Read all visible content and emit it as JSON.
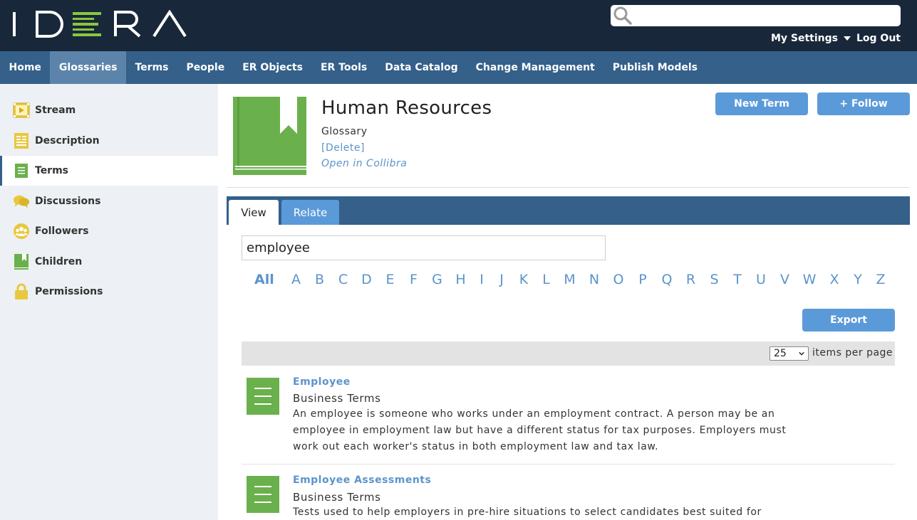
{
  "header": {
    "logo_text": "IDERA",
    "search_placeholder": "",
    "my_settings": "My Settings",
    "log_out": "Log Out"
  },
  "nav": {
    "items": [
      "Home",
      "Glossaries",
      "Terms",
      "People",
      "ER Objects",
      "ER Tools",
      "Data Catalog",
      "Change Management",
      "Publish Models"
    ],
    "active": "Glossaries"
  },
  "sidebar": {
    "items": [
      {
        "label": "Stream",
        "icon": "stream-icon"
      },
      {
        "label": "Description",
        "icon": "description-icon"
      },
      {
        "label": "Terms",
        "icon": "terms-icon"
      },
      {
        "label": "Discussions",
        "icon": "discussions-icon"
      },
      {
        "label": "Followers",
        "icon": "followers-icon"
      },
      {
        "label": "Children",
        "icon": "children-icon"
      },
      {
        "label": "Permissions",
        "icon": "lock-icon"
      }
    ],
    "active": "Terms"
  },
  "glossary": {
    "title": "Human Resources",
    "type": "Glossary",
    "delete_link": "[Delete]",
    "collibra_link": "Open in Collibra",
    "new_term_button": "New Term",
    "follow_button": "+ Follow"
  },
  "tabs": {
    "view": "View",
    "relate": "Relate",
    "active": "View"
  },
  "filter": {
    "value": "employee",
    "letters": [
      "All",
      "A",
      "B",
      "C",
      "D",
      "E",
      "F",
      "G",
      "H",
      "I",
      "J",
      "K",
      "L",
      "M",
      "N",
      "O",
      "P",
      "Q",
      "R",
      "S",
      "T",
      "U",
      "V",
      "W",
      "X",
      "Y",
      "Z"
    ],
    "active_letter": "All",
    "export_button": "Export"
  },
  "pager": {
    "per_page_value": "25",
    "per_page_label": "items per page"
  },
  "terms": [
    {
      "name": "Employee",
      "type": "Business Terms",
      "description": "An employee is someone who works under an employment contract. A person may be an employee in employment law but have a different status for tax purposes. Employers must work out each worker's status in both employment law and tax law."
    },
    {
      "name": "Employee Assessments",
      "type": "Business Terms",
      "description": "Tests used to help employers in pre-hire situations to select candidates best suited for"
    }
  ],
  "colors": {
    "topbar": "#18283a",
    "nav": "#34608a",
    "nav_active": "#5c84aa",
    "accent_blue": "#5b9ad9",
    "link": "#5b94cb",
    "green": "#6ab04c",
    "sidebar_bg": "#edf0f4"
  }
}
